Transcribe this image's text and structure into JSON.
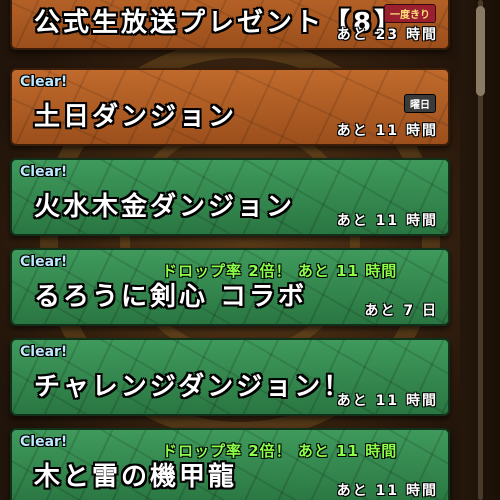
{
  "dungeon_list": [
    {
      "title": "公式生放送プレゼント【8】",
      "cleared": false,
      "clear_label": "",
      "badge": "一度きり",
      "bonus": "",
      "remaining": "あと 23 時間",
      "theme": "brown"
    },
    {
      "title": "土日ダンジョン",
      "cleared": true,
      "clear_label": "Clear!",
      "badge": "曜日",
      "bonus": "",
      "remaining": "あと 11 時間",
      "theme": "brown"
    },
    {
      "title": "火水木金ダンジョン",
      "cleared": true,
      "clear_label": "Clear!",
      "badge": "",
      "bonus": "",
      "remaining": "あと 11 時間",
      "theme": "green"
    },
    {
      "title": "るろうに剣心 コラボ",
      "cleared": true,
      "clear_label": "Clear!",
      "badge": "",
      "bonus": "ドロップ率 2倍！ あと 11 時間",
      "remaining": "あと 7 日",
      "theme": "green"
    },
    {
      "title": "チャレンジダンジョン！",
      "cleared": true,
      "clear_label": "Clear!",
      "badge": "",
      "bonus": "",
      "remaining": "あと 11 時間",
      "theme": "green"
    },
    {
      "title": "木と雷の機甲龍",
      "cleared": true,
      "clear_label": "Clear!",
      "badge": "",
      "bonus": "ドロップ率 2倍！ あと 11 時間",
      "remaining": "あと 11 時間",
      "theme": "green"
    }
  ],
  "colors": {
    "brown_panel": "#b05e26",
    "green_panel": "#35884f",
    "clear_text": "#bfe9ff",
    "bonus_text": "#8cff4a",
    "once_badge": "#9a2030"
  }
}
